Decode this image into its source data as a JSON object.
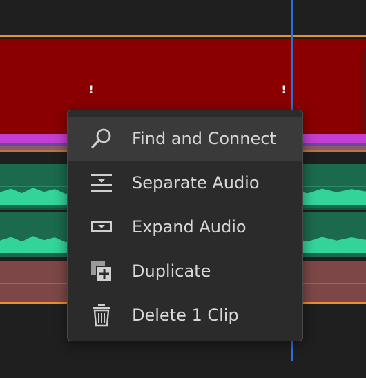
{
  "menu": {
    "items": [
      {
        "label": "Find and Connect",
        "icon": "search-icon",
        "highlighted": true
      },
      {
        "label": "Separate Audio",
        "icon": "separate-audio-icon"
      },
      {
        "label": "Expand Audio",
        "icon": "expand-audio-icon"
      },
      {
        "label": "Duplicate",
        "icon": "duplicate-icon"
      },
      {
        "label": "Delete 1 Clip",
        "icon": "trash-icon"
      }
    ]
  },
  "timeline": {
    "warning_markers": [
      "!",
      "!"
    ],
    "colors": {
      "background": "#1f1f1f",
      "video_clip": "#8a0000",
      "audio_clip": "#1b6a4d",
      "waveform": "#33d49a",
      "title_clip": "#c23fd1",
      "playhead": "#2f6fdb",
      "range_line": "#e8912f"
    }
  }
}
